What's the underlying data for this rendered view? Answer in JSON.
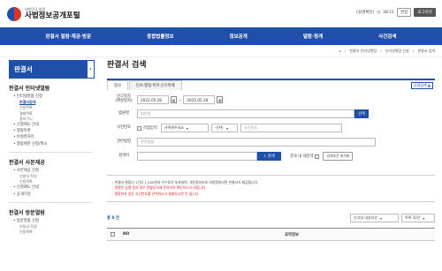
{
  "header": {
    "logo_sub": "대한민국 법원",
    "logo_main": "사법정보공개포털",
    "session_label": "(실명확인)",
    "session_time": "28:11",
    "extend_label": "연장",
    "logout_label": "로그아웃"
  },
  "nav": [
    "판결서 열람·제공·방문",
    "종합법률정보",
    "정보공개",
    "열람·청계",
    "사건검색"
  ],
  "breadcrumb": [
    "판결서 인터넷열람",
    "인터넷열람 신청",
    "판결서 검색"
  ],
  "sidebar": {
    "title": "판결서",
    "sections": [
      {
        "title": "판결서 인터넷열람",
        "items": [
          {
            "label": "인터넷열람 신청",
            "subs": [
              "판결서검색",
              "신청목록",
              "결제목록",
              "장바구니"
            ],
            "active": 0
          },
          {
            "label": "신청제도 안내",
            "subs": []
          },
          {
            "label": "열람목록",
            "subs": []
          },
          {
            "label": "비실명처리",
            "subs": []
          },
          {
            "label": "열람제한 신청/취소",
            "subs": []
          }
        ]
      },
      {
        "title": "판결서 사본제공",
        "items": [
          {
            "label": "사본제공 신청",
            "subs": [
              "신청서 작성",
              "신청목록"
            ]
          },
          {
            "label": "신청제도 안내",
            "subs": []
          },
          {
            "label": "공개기관",
            "subs": []
          }
        ]
      },
      {
        "title": "판결서 방문열람",
        "items": [
          {
            "label": "방문열람 신청",
            "subs": [
              "신청서 작성",
              "신청목록"
            ]
          }
        ]
      }
    ]
  },
  "page_title": "판결서 검색",
  "tabs": [
    "형사",
    "민사·행정·특허·신기특례"
  ],
  "detail_search_label": "상세검색 ▲",
  "form": {
    "date_label": "선고일자\n(확정일자)",
    "date_from": "2022.05.28",
    "date_to": "2025.05.28",
    "court_label": "법원명",
    "court_placeholder": "법원명",
    "court_btn": "선택",
    "case_label": "사건번호",
    "direct_input_label": "직접입력",
    "case_year": "선택해주세요",
    "case_type": "-선택-",
    "case_no_placeholder": "사건번호",
    "keyword_label": "관련법령",
    "keyword_placeholder": "관련법령",
    "search_label": "검색어",
    "search_btn": "검색",
    "result_in_label": "결과 내 재검색",
    "reset_btn": "검색조건 초기화"
  },
  "notice": [
    "- 판결서 열람시 1건당 1,000원의 수수료가 부과되며, 개인정보보호 비실명처리된 판결서가 제공됩니다.",
    "- 개명된 성명 등의 경우 관할부서에 문의하여 확인하시기 바랍니다.",
    "- 열람하지 않은 사건번호를 선택하시고 결제하시면 안 됩니다."
  ],
  "results": {
    "count": "총 0 건",
    "sort": "선고일 내림차순",
    "per_page": "목록 10건"
  },
  "table": {
    "col_no": "NO",
    "col_summary": "요약정보"
  },
  "colors": {
    "primary": "#1f4fa8",
    "alert": "#d22222"
  }
}
